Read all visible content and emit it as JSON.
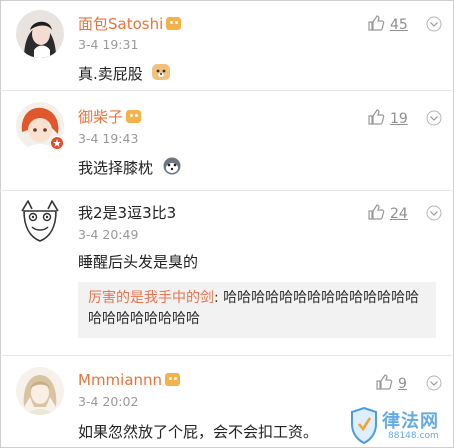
{
  "comments": [
    {
      "user": "面包Satoshi",
      "time": "3-4 19:31",
      "text": "真.卖屁股",
      "likes": "45"
    },
    {
      "user": "御柴子",
      "time": "3-4 19:43",
      "text": "我选择膝枕",
      "likes": "19"
    },
    {
      "user": "我2是3逗3比3",
      "time": "3-4 20:49",
      "text": "睡醒后头发是臭的",
      "likes": "24",
      "reply": {
        "user": "厉害的是我手中的剑",
        "sep": ":",
        "text": " 哈哈哈哈哈哈哈哈哈哈哈哈哈哈哈哈哈哈哈哈哈哈"
      }
    },
    {
      "user": "Mmmiannn",
      "time": "3-4 20:02",
      "text": "如果忽然放了个屁，会不会扣工资。",
      "likes": "9"
    }
  ],
  "watermark": {
    "title": "律法网",
    "url": "88148.com"
  },
  "colors": {
    "username": "#e8743b",
    "reply_user": "#eb7350",
    "muted": "#9a9a9a"
  }
}
